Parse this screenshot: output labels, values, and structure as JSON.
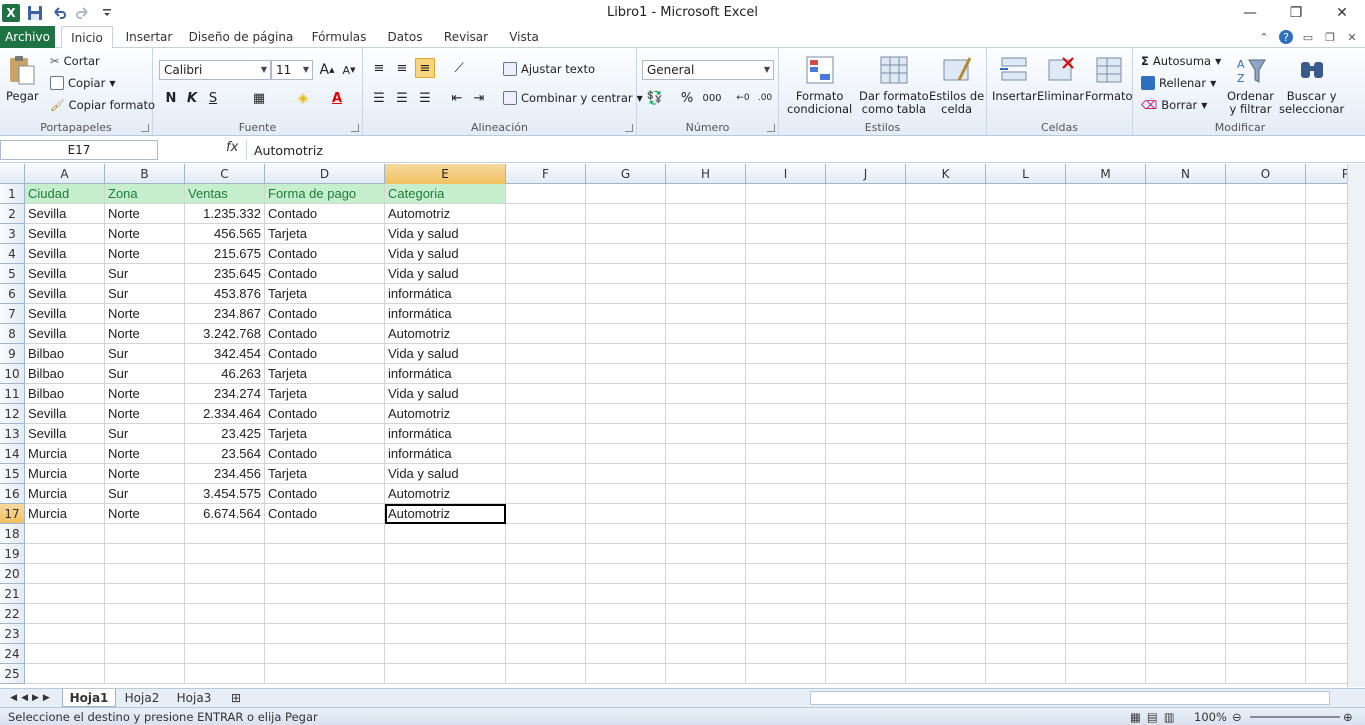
{
  "window": {
    "title": "Libro1  -  Microsoft Excel",
    "controls": [
      "—",
      "❐",
      "✕"
    ]
  },
  "qat": {
    "logo": "X",
    "items": [
      "save-icon",
      "undo-icon",
      "redo-icon",
      "customize-icon"
    ]
  },
  "tabs": [
    "Archivo",
    "Inicio",
    "Insertar",
    "Diseño de página",
    "Fórmulas",
    "Datos",
    "Revisar",
    "Vista"
  ],
  "ribbon": {
    "clipboard": {
      "label": "Portapapeles",
      "paste": "Pegar",
      "cut": "Cortar",
      "copy": "Copiar",
      "format_painter": "Copiar formato"
    },
    "font": {
      "label": "Fuente",
      "name": "Calibri",
      "size": "11",
      "bold": "N",
      "italic": "K",
      "underline": "S"
    },
    "alignment": {
      "label": "Alineación",
      "wrap": "Ajustar texto",
      "merge": "Combinar y centrar"
    },
    "number": {
      "label": "Número",
      "format": "General",
      "percent": "%",
      "thousands": "000"
    },
    "styles": {
      "label": "Estilos",
      "cond1": "Formato",
      "cond2": "condicional",
      "table1": "Dar formato",
      "table2": "como tabla",
      "cell1": "Estilos de",
      "cell2": "celda"
    },
    "cells": {
      "label": "Celdas",
      "insert": "Insertar",
      "delete": "Eliminar",
      "format": "Formato"
    },
    "editing": {
      "label": "Modificar",
      "autosum": "Autosuma",
      "fill": "Rellenar",
      "clear": "Borrar",
      "sort1": "Ordenar",
      "sort2": "y filtrar",
      "find1": "Buscar y",
      "find2": "seleccionar"
    }
  },
  "formula_bar": {
    "name_box": "E17",
    "fx": "fx",
    "content": "Automotriz"
  },
  "columns": [
    "A",
    "B",
    "C",
    "D",
    "E",
    "F",
    "G",
    "H",
    "I",
    "J",
    "K",
    "L",
    "M",
    "N",
    "O",
    "P"
  ],
  "rows": [
    [
      "Ciudad",
      "Zona",
      "Ventas",
      "Forma de pago",
      "Categoria"
    ],
    [
      "Sevilla",
      "Norte",
      "1.235.332",
      "Contado",
      "Automotriz"
    ],
    [
      "Sevilla",
      "Norte",
      "456.565",
      "Tarjeta",
      "Vida y salud"
    ],
    [
      "Sevilla",
      "Norte",
      "215.675",
      "Contado",
      "Vida y salud"
    ],
    [
      "Sevilla",
      "Sur",
      "235.645",
      "Contado",
      "Vida y salud"
    ],
    [
      "Sevilla",
      "Sur",
      "453.876",
      "Tarjeta",
      "informática"
    ],
    [
      "Sevilla",
      "Norte",
      "234.867",
      "Contado",
      "informática"
    ],
    [
      "Sevilla",
      "Norte",
      "3.242.768",
      "Contado",
      "Automotriz"
    ],
    [
      "Bilbao",
      "Sur",
      "342.454",
      "Contado",
      "Vida y salud"
    ],
    [
      "Bilbao",
      "Sur",
      "46.263",
      "Tarjeta",
      "informática"
    ],
    [
      "Bilbao",
      "Norte",
      "234.274",
      "Tarjeta",
      "Vida y salud"
    ],
    [
      "Sevilla",
      "Norte",
      "2.334.464",
      "Contado",
      "Automotriz"
    ],
    [
      "Sevilla",
      "Sur",
      "23.425",
      "Tarjeta",
      "informática"
    ],
    [
      "Murcia",
      "Norte",
      "23.564",
      "Contado",
      "informática"
    ],
    [
      "Murcia",
      "Norte",
      "234.456",
      "Tarjeta",
      "Vida y salud"
    ],
    [
      "Murcia",
      "Sur",
      "3.454.575",
      "Contado",
      "Automotriz"
    ],
    [
      "Murcia",
      "Norte",
      "6.674.564",
      "Contado",
      "Automotriz"
    ]
  ],
  "total_rows": 25,
  "active_cell": {
    "row": 17,
    "col": "E"
  },
  "sheets": [
    "Hoja1",
    "Hoja2",
    "Hoja3"
  ],
  "status": {
    "message": "Seleccione el destino y presione ENTRAR o elija Pegar",
    "zoom": "100%"
  },
  "colors": {
    "excel_green": "#1f7244",
    "header_fill": "#c6efce",
    "header_text": "#1e7b3c",
    "selected_header": "#f1c15f"
  }
}
